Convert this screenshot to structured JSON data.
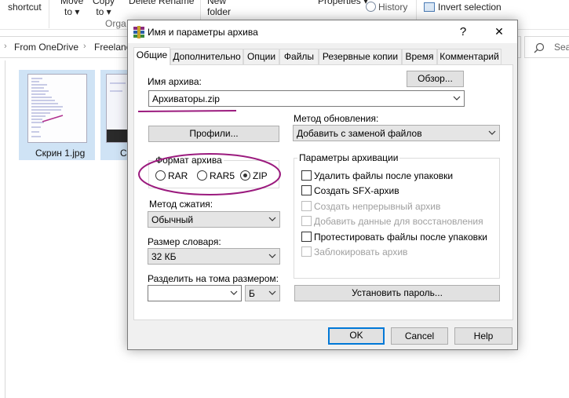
{
  "explorer": {
    "ribbon": {
      "copy_shortcut": "shortcut",
      "move_to": [
        "Move",
        "to ▾"
      ],
      "copy_to": [
        "Copy",
        "to ▾"
      ],
      "delete_rename": "Delete  Rename",
      "new_folder": [
        "New",
        "folder"
      ],
      "properties": "Properties ▾",
      "history": "History",
      "invert_selection": "Invert selection",
      "group_organize": "Orga"
    },
    "breadcrumb": [
      "From OneDrive",
      "Freelanc"
    ],
    "search_placeholder": "Sea",
    "files": [
      {
        "name": "Скрин 1.jpg"
      },
      {
        "name": "С"
      }
    ]
  },
  "dialog": {
    "title": "Имя и параметры архива",
    "help_symbol": "?",
    "close_symbol": "✕",
    "tabs": [
      "Общие",
      "Дополнительно",
      "Опции",
      "Файлы",
      "Резервные копии",
      "Время",
      "Комментарий"
    ],
    "active_tab": 0,
    "archive_name_label": "Имя архива:",
    "browse_button": "Обзор...",
    "archive_name_value": "Архиваторы.zip",
    "update_method_label": "Метод обновления:",
    "update_method_value": "Добавить с заменой файлов",
    "profiles_button": "Профили...",
    "archive_format": {
      "title": "Формат архива",
      "options": [
        "RAR",
        "RAR5",
        "ZIP"
      ],
      "selected": 2
    },
    "compression_label": "Метод сжатия:",
    "compression_value": "Обычный",
    "dictionary_label": "Размер словаря:",
    "dictionary_value": "32 КБ",
    "split_label": "Разделить на тома размером:",
    "split_value": "",
    "split_unit": "Б",
    "archiving_params": {
      "title": "Параметры архивации",
      "options": [
        {
          "label": "Удалить файлы после упаковки",
          "checked": false,
          "enabled": true
        },
        {
          "label": "Создать SFX-архив",
          "checked": false,
          "enabled": true
        },
        {
          "label": "Создать непрерывный архив",
          "checked": false,
          "enabled": false
        },
        {
          "label": "Добавить данные для восстановления",
          "checked": false,
          "enabled": false
        },
        {
          "label": "Протестировать файлы после упаковки",
          "checked": false,
          "enabled": true
        },
        {
          "label": "Заблокировать архив",
          "checked": false,
          "enabled": false
        }
      ]
    },
    "set_password_button": "Установить пароль...",
    "ok_button": "OK",
    "cancel_button": "Cancel",
    "help_button": "Help"
  },
  "colors": {
    "annotation": "#9b1b7e",
    "selection_blue": "#cfe3f5",
    "focus_blue": "#0078d7"
  }
}
